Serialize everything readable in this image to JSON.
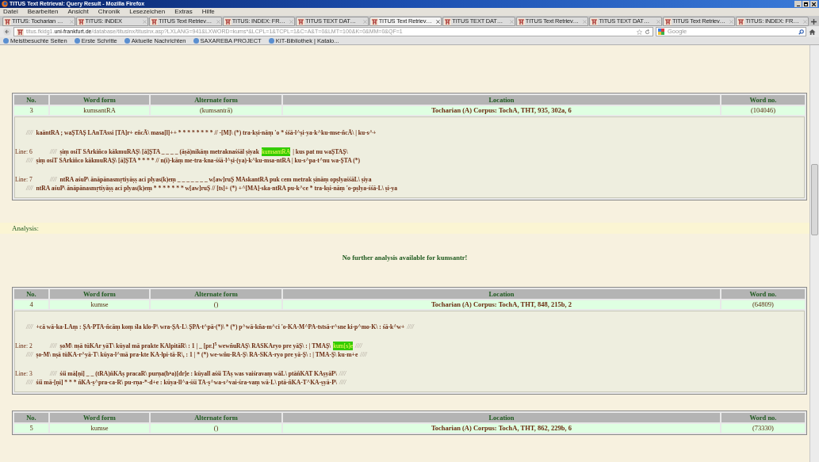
{
  "window": {
    "title": "TITUS Text Retrieval: Query Result - Mozilla Firefox"
  },
  "menu": [
    "Datei",
    "Bearbeiten",
    "Ansicht",
    "Chronik",
    "Lesezeichen",
    "Extras",
    "Hilfe"
  ],
  "tabs": [
    {
      "label": "TITUS: Tocharian …",
      "selected": false
    },
    {
      "label": "TITUS: INDEX",
      "selected": false
    },
    {
      "label": "TITUS Text Retriev…",
      "selected": false
    },
    {
      "label": "TITUS: INDEX: FR…",
      "selected": false
    },
    {
      "label": "TITUS TEXT DAT…",
      "selected": false
    },
    {
      "label": "TITUS Text Retriev…",
      "selected": true
    },
    {
      "label": "TITUS TEXT DAT…",
      "selected": false
    },
    {
      "label": "TITUS Text Retriev…",
      "selected": false
    },
    {
      "label": "TITUS TEXT DAT…",
      "selected": false
    },
    {
      "label": "TITUS Text Retriev…",
      "selected": false
    },
    {
      "label": "TITUS: INDEX: FR…",
      "selected": false
    }
  ],
  "address": {
    "host_pre": "titus.fkidg1.",
    "host": "uni-frankfurt.de",
    "path": "/database/titusinx/titusinx.asp?LXLANG=941&LXWORD=kums*&LCPL=1&TCPL=1&C=A&T=0&LMT=100&K=0&MM=0&QF=1"
  },
  "search": {
    "placeholder": "Google"
  },
  "bookmarks": [
    "Meistbesuchte Seiten",
    "Erste Schritte",
    "Aktuelle Nachrichten",
    "SAXAREBA PROJECT",
    "KIT-Bibliothek | Katalo..."
  ],
  "results": [
    {
      "columns": [
        "No.",
        "Word form",
        "Alternate form",
        "Location",
        "Word no."
      ],
      "cells": [
        "3",
        "kumsantRA",
        "(kumsantrā)",
        "Tocharian (A) Corpus: TochA, THT, 935, 302a, 6",
        "(104046)"
      ],
      "groups": [
        [
          {
            "parts": [
              {
                "kind": "slashes",
                "text": "////"
              },
              {
                "kind": "text",
                "text": "kaäntRA ; waȘTAȘ LAnTAssi [TA]r+ eñcÃ\\ masa[l]++ * * * * * * * * // -[M]\\ (*) tra-kṣi-nāṃ 'o * śśā-l^ṣi-ya-k^ku-mse-ñcÃ\\ | ku-s^+"
              }
            ]
          }
        ],
        [
          {
            "label": "Line: 6",
            "parts": [
              {
                "kind": "slashes",
                "text": "////"
              },
              {
                "kind": "text",
                "text": "ṣiṃ osiT SArkiñco kākmuRAȘ\\ [ā]ȘTA _ _ _ _ (āṣā)nikāṃ metraknaśśāl ṣiyak"
              },
              {
                "kind": "hit",
                "text": "kumsantRA"
              },
              {
                "kind": "text",
                "text": "| kus pat nu waȘTAȘ\\"
              }
            ]
          },
          {
            "parts": [
              {
                "kind": "slashes",
                "text": "////"
              },
              {
                "kind": "text",
                "text": "ṣiṃ osiT SArkiñco kākmuRAȘ\\ [ā]ȘTA * * * * // n(i)-kāṃ me-tra-kna-śśā-l^ṣi-(ya)-k^ku-msa-ntRA | ku-s^pa-t^nu wa-ȘTA (*)"
              }
            ]
          }
        ],
        [
          {
            "label": "Line: 7",
            "parts": [
              {
                "kind": "slashes",
                "text": "////"
              },
              {
                "kind": "text",
                "text": "ntRA aśuP\\ ānāpānasmṛtiyāṣṣ aci plyas(k)eṃ _ _ _ _ _ _ _ w[aw]ruȘ MAskantRA puk cem metrak ṣināṃ opṣlyaśśāL\\ ṣiya"
              }
            ]
          },
          {
            "parts": [
              {
                "kind": "slashes",
                "text": "////"
              },
              {
                "kind": "text",
                "text": "ntRA aśuP\\ ānāpānasmṛtiyāṣṣ aci plyas(k)eṃ * * * * * * * w[aw]ruȘ // [ts]+ (*) +^[MA]-ska-ntRA pu-k^ce * tra-kṣi-nāṃ 'o-pṣlya-śśā-L\\ ṣi-ya"
              }
            ]
          }
        ]
      ],
      "analysis": {
        "heading": "Analysis:",
        "message": "No further analysis available for kumsantr!"
      }
    },
    {
      "columns": [
        "No.",
        "Word form",
        "Alternate form",
        "Location",
        "Word no."
      ],
      "cells": [
        "4",
        "kumse",
        "()",
        "Tocharian (A) Corpus: TochA, THT, 848, 215b, 2",
        "(64809)"
      ],
      "groups": [
        [
          {
            "parts": [
              {
                "kind": "slashes",
                "text": "////"
              },
              {
                "kind": "text",
                "text": "+cā wā-ka-LAṃ : ȘA-PTA-ñcāṃ koṃ śla klo-P\\ wra-ȘA-L\\ ȘPA-t^pā-(*)\\ * (*) p^wā-kña-m^ci 'o-KA-M^PA-tstsā-r^sne ki-p^mo-K\\ : śā-k^w+"
              },
              {
                "kind": "slashes",
                "text": "////"
              }
            ]
          }
        ],
        [
          {
            "label": "Line: 2",
            "parts": [
              {
                "kind": "slashes",
                "text": "////"
              },
              {
                "kind": "text",
                "text": "ṣoM\\ nṣā tüKAr yāT\\ kūyal mā prakte KAlpitāR\\ : 1 | _ [pr.]$^{5}$ wewñuRAȘ\\ RASKAryo pre yāȘ\\ : | TMAȘ\\"
              },
              {
                "kind": "hit",
                "text": "kum[s]e"
              },
              {
                "kind": "slashes",
                "text": "////"
              }
            ]
          },
          {
            "parts": [
              {
                "kind": "slashes",
                "text": "////"
              },
              {
                "kind": "text",
                "text": "ṣo-M\\ nṣā tüKA-r^yā-T\\ kūya-l^mā pra-kte KA-lpi-tā-R\\, : 1 | * (*) we-wñu-RA-Ș\\ RA-SKA-ryo pre yā-Ș\\ : | TMA-Ș\\ ku-m+e"
              },
              {
                "kind": "slashes",
                "text": "////"
              }
            ]
          }
        ],
        [
          {
            "label": "Line: 3",
            "parts": [
              {
                "kind": "slashes",
                "text": "////"
              },
              {
                "kind": "text",
                "text": "śśi mā[ṇi] _ _ (tRA)ñKAṣ pracaR\\ purṇa(bʰa)[dr]e : kūyall aśśi TAṣ was vaiśravaṃ wāL\\ ptāñKAT KAṣyāP\\"
              },
              {
                "kind": "slashes",
                "text": "////"
              }
            ]
          },
          {
            "parts": [
              {
                "kind": "slashes",
                "text": "////"
              },
              {
                "kind": "text",
                "text": "śśi mā-[ṇi] * * * ñKA-ṣ^pra-ca-R\\ pu-rṇa-*-d+e : kūya-ll^a-śśi TA-ṣ^wa-s^vai-śra-vaṃ wā-L\\ ptā-ñKA-T^KA-ṣyā-P\\"
              },
              {
                "kind": "slashes",
                "text": "////"
              }
            ]
          }
        ]
      ]
    },
    {
      "columns": [
        "No.",
        "Word form",
        "Alternate form",
        "Location",
        "Word no."
      ],
      "cells": [
        "5",
        "kumse",
        "()",
        "Tocharian (A) Corpus: TochA, THT, 862, 229b, 6",
        "(73330)"
      ]
    }
  ]
}
